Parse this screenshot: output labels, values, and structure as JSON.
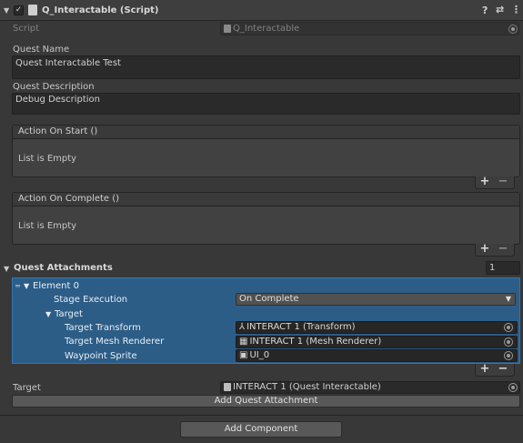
{
  "component": {
    "title": "Q_Interactable (Script)",
    "help_icon": "help-icon",
    "settings_icon": "sliders-icon",
    "menu_icon": "kebab-menu-icon"
  },
  "script": {
    "label": "Script",
    "value": "Q_Interactable"
  },
  "quest_name": {
    "label": "Quest Name",
    "value": "Quest Interactable Test"
  },
  "quest_description": {
    "label": "Quest Description",
    "value": "Debug Description"
  },
  "action_on_start": {
    "header": "Action On Start ()",
    "empty_text": "List is Empty",
    "add": "+",
    "remove": "−"
  },
  "action_on_complete": {
    "header": "Action On Complete ()",
    "empty_text": "List is Empty",
    "add": "+",
    "remove": "−"
  },
  "quest_attachments": {
    "label": "Quest Attachments",
    "count": "1",
    "element": {
      "label": "Element 0",
      "stage_execution": {
        "label": "Stage Execution",
        "value": "On Complete"
      },
      "target_group": "Target",
      "target_transform": {
        "label": "Target Transform",
        "value": "INTERACT 1 (Transform)"
      },
      "target_mesh_renderer": {
        "label": "Target Mesh Renderer",
        "value": "INTERACT 1 (Mesh Renderer)"
      },
      "waypoint_sprite": {
        "label": "Waypoint Sprite",
        "value": "UI_0"
      }
    },
    "add": "+",
    "remove": "−"
  },
  "target": {
    "label": "Target",
    "value": "INTERACT 1 (Quest Interactable)"
  },
  "add_quest_attachment": "Add Quest Attachment",
  "add_component": "Add Component",
  "colors": {
    "selection_blue": "#2c5d87",
    "panel_bg": "#383838",
    "field_bg": "#2a2a2a"
  }
}
